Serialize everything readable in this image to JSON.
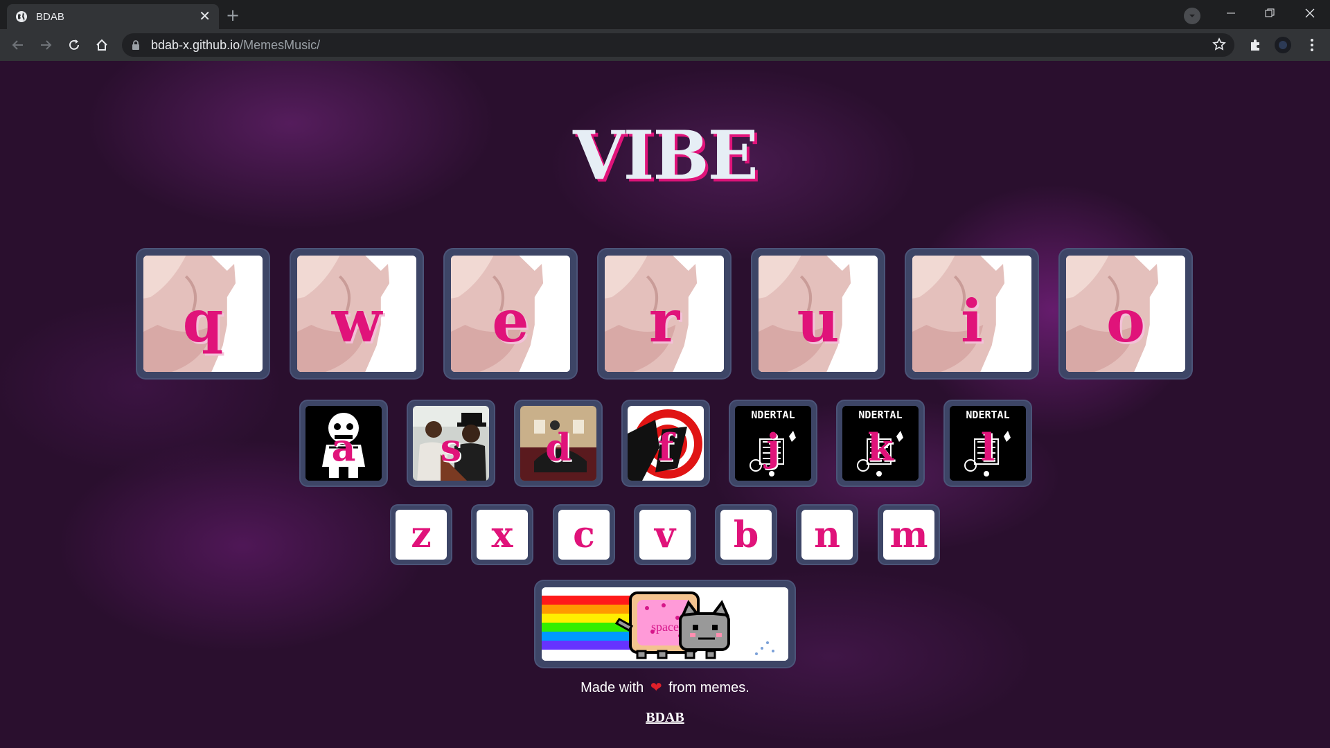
{
  "browser": {
    "tab_title": "BDAB",
    "new_tab_label": "+",
    "url_host": "bdab-x.github.io",
    "url_path": "/MemesMusic/"
  },
  "page": {
    "title": "VIBE",
    "row1": [
      {
        "key": "q",
        "image": "cat-vibing-image"
      },
      {
        "key": "w",
        "image": "cat-vibing-image"
      },
      {
        "key": "e",
        "image": "cat-vibing-image"
      },
      {
        "key": "r",
        "image": "cat-vibing-image"
      },
      {
        "key": "u",
        "image": "cat-vibing-image"
      },
      {
        "key": "i",
        "image": "cat-vibing-image"
      },
      {
        "key": "o",
        "image": "cat-vibing-image"
      }
    ],
    "row2": [
      {
        "key": "a",
        "image": "sans-skeleton-image"
      },
      {
        "key": "s",
        "image": "coffin-dance-image"
      },
      {
        "key": "d",
        "image": "dark-room-image"
      },
      {
        "key": "f",
        "image": "red-spiral-logo-image"
      },
      {
        "key": "j",
        "image": "undertale-image",
        "banner": "NDERTAL"
      },
      {
        "key": "k",
        "image": "undertale-image",
        "banner": "NDERTAL"
      },
      {
        "key": "l",
        "image": "undertale-image",
        "banner": "NDERTAL"
      }
    ],
    "row3": [
      "z",
      "x",
      "c",
      "v",
      "b",
      "n",
      "m"
    ],
    "space_key": {
      "label": "space",
      "image": "nyan-cat-image"
    },
    "footer": {
      "made_with": "Made with",
      "heart": "❤",
      "from_memes": "from memes.",
      "link": "BDAB"
    },
    "colors": {
      "accent": "#e0137a",
      "key_border": "#3d4566",
      "background": "#2a0f2e"
    }
  }
}
